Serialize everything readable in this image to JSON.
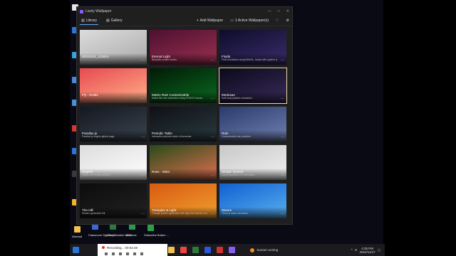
{
  "window": {
    "title": "Lively Wallpaper",
    "controls": [
      "—",
      "□",
      "✕"
    ]
  },
  "toolbar": {
    "tabs": [
      {
        "label": "Library",
        "icon": "library-icon"
      },
      {
        "label": "Gallery",
        "icon": "gallery-icon"
      }
    ],
    "add_wallpaper": "Add Wallpaper",
    "active_wallpapers": "1 Active Wallpaper(s)"
  },
  "cards": [
    {
      "title": "20221011_112815",
      "desc": "",
      "colors": [
        "#dcdcdc",
        "#aaa"
      ]
    },
    {
      "title": "Eternal Light",
      "desc": "Beautiful sunset render.",
      "colors": [
        "#4d1030",
        "#9b3050"
      ]
    },
    {
      "title": "Fluids",
      "desc": "Fluid simulation using WebGL, reacts with system audio & cursor.",
      "colors": [
        "#0d0c2a",
        "#3b2d6a"
      ]
    },
    {
      "title": "Fly - 61381",
      "desc": "",
      "colors": [
        "#e84a50",
        "#ffb08a"
      ]
    },
    {
      "title": "Matrix Rain Customizable",
      "desc": "Matrix like rain animation using HTML5 Canvas.",
      "colors": [
        "#011a06",
        "#0a6a20"
      ]
    },
    {
      "title": "Medusae",
      "desc": "Soft body jellyfish simulation.",
      "colors": [
        "#0a0a1a",
        "#3a2a5a"
      ]
    },
    {
      "title": "Parallax.js",
      "desc": "Parallax.js engine github page.",
      "colors": [
        "#141820",
        "#3a4450"
      ]
    },
    {
      "title": "Periodic Table",
      "desc": "Interactive periodic table of elements.",
      "colors": [
        "#0f1015",
        "#2a3a40"
      ]
    },
    {
      "title": "Rain",
      "desc": "Customizable rain particles.",
      "colors": [
        "#2a3a6a",
        "#7080b0"
      ]
    },
    {
      "title": "Ripples",
      "desc": "Ripple that shows weather.",
      "colors": [
        "#dcdcdc",
        "#ffffff"
      ]
    },
    {
      "title": "Rose - 3654",
      "desc": "",
      "colors": [
        "#2a4a1a",
        "#e07050"
      ]
    },
    {
      "title": "Simple System",
      "desc": "Lively hardware API showcase.",
      "colors": [
        "#c8c8c8",
        "#f0f0f0"
      ]
    },
    {
      "title": "The Hill",
      "desc": "Shader generated hill.",
      "colors": [
        "#0c0c0c",
        "#222"
      ]
    },
    {
      "title": "Triangles & Light",
      "desc": "Triangle pattern generator with light that follows cursor.",
      "colors": [
        "#d85a10",
        "#f0a030"
      ]
    },
    {
      "title": "Waves",
      "desc": "Three.js wave simulation.",
      "colors": [
        "#1060d0",
        "#5ab0f0"
      ]
    }
  ],
  "desktop": {
    "bottom_icons": [
      "Aforead",
      "Classroom Spy Profe...",
      "Sabry October 2022",
      "welcome",
      "Subscribe Button ..."
    ]
  },
  "taskbar": {
    "recording": "Recording...  00:02:48",
    "weather": "Sunset coming",
    "time": "4:35 PM",
    "date": "2022/11/17"
  }
}
